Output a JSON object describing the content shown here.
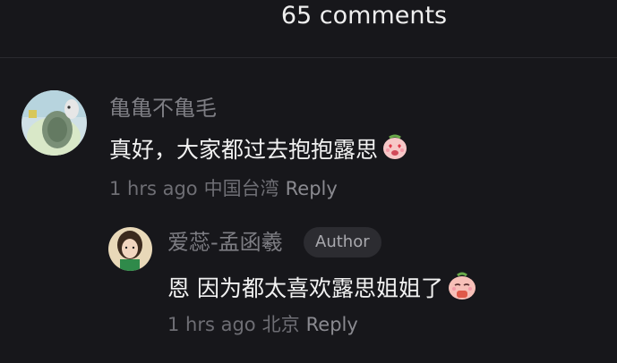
{
  "header": {
    "title": "65 comments"
  },
  "comments": [
    {
      "username": "亀亀不亀毛",
      "text": "真好，大家都过去抱抱露思",
      "time": "1 hrs ago",
      "location": "中国台湾",
      "reply_label": "Reply",
      "avatar_icon": "turtle-plush-avatar",
      "emoji_icon": "heart-eyes-peach-emoji"
    },
    {
      "username": "爱蕊-孟函羲",
      "badge": "Author",
      "text": "恩 因为都太喜欢露思姐姐了",
      "time": "1 hrs ago",
      "location": "北京",
      "reply_label": "Reply",
      "avatar_icon": "girl-photo-avatar",
      "emoji_icon": "bowing-peach-emoji"
    }
  ],
  "colors": {
    "background": "#17171b",
    "primary_text": "#f2f2f2",
    "secondary_text": "#7d7d83",
    "badge_bg": "#2c2c31"
  }
}
